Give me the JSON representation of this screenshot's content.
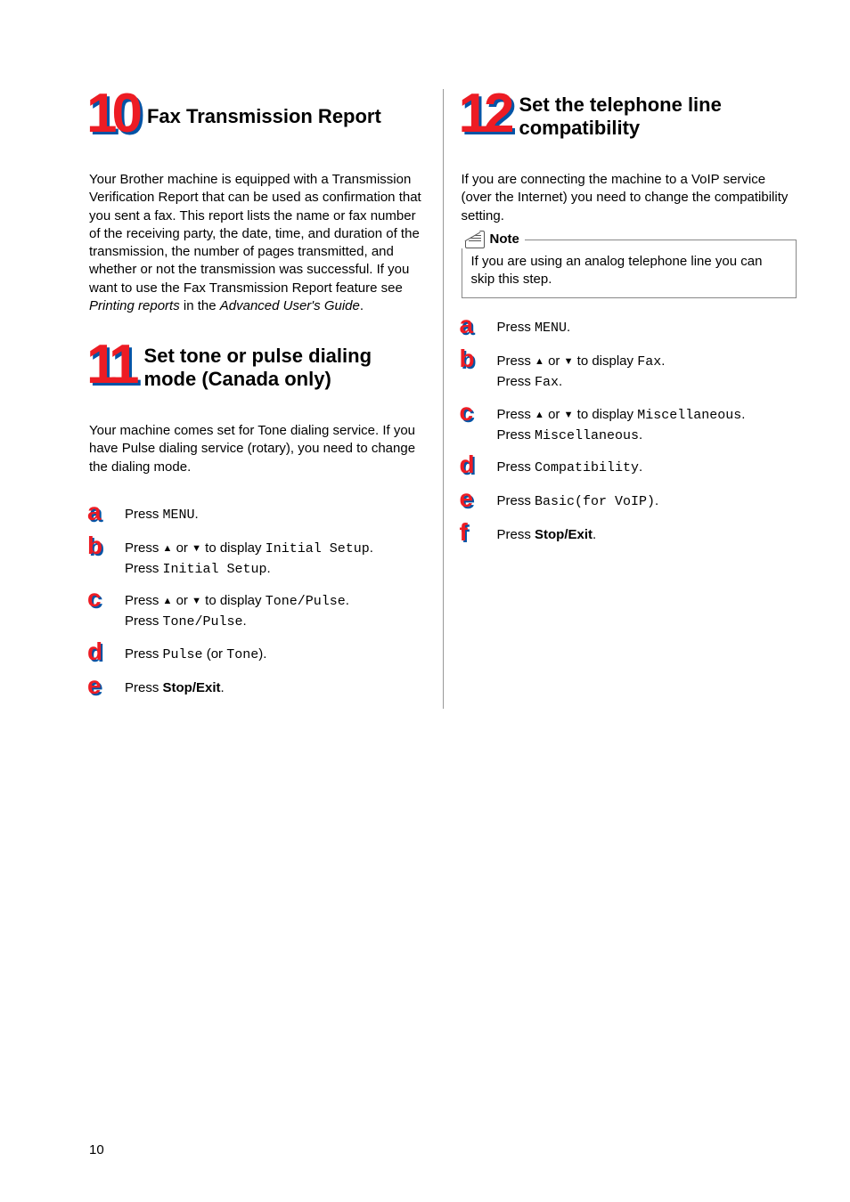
{
  "page_number": "10",
  "left": {
    "sections": [
      {
        "num": "10",
        "title": "Fax Transmission Report",
        "body_parts": [
          "Your Brother machine is equipped with a Transmission Verification Report that can be used as confirmation that you sent a fax. This report lists the name or fax number of the receiving party, the date, time, and duration of the transmission, the number of pages transmitted, and whether or not the transmission was successful. If you want to use the Fax Transmission Report feature see ",
          "Printing reports",
          " in the ",
          "Advanced User's Guide",
          "."
        ]
      },
      {
        "num": "11",
        "title": "Set tone or pulse dialing mode (Canada only)",
        "body": "Your machine comes set for Tone dialing service. If you have Pulse dialing service (rotary), you need to change the dialing mode.",
        "steps": {
          "a": {
            "t1": "Press ",
            "m1": "MENU",
            "t2": "."
          },
          "b": {
            "line1": {
              "t1": "Press ",
              "up": "▲",
              "mid": " or ",
              "down": "▼",
              "t2": " to display ",
              "m1": "Initial Setup",
              "t3": "."
            },
            "line2": {
              "t1": "Press ",
              "m1": "Initial Setup",
              "t2": "."
            }
          },
          "c": {
            "line1": {
              "t1": "Press ",
              "up": "▲",
              "mid": " or ",
              "down": "▼",
              "t2": " to display ",
              "m1": "Tone/Pulse",
              "t3": "."
            },
            "line2": {
              "t1": "Press ",
              "m1": "Tone/Pulse",
              "t2": "."
            }
          },
          "d": {
            "t1": "Press ",
            "m1": "Pulse",
            "t2": " (or ",
            "m2": "Tone",
            "t3": ")."
          },
          "e": {
            "t1": "Press ",
            "b1": "Stop/Exit",
            "t2": "."
          }
        }
      }
    ]
  },
  "right": {
    "section": {
      "num": "12",
      "title": "Set the telephone line compatibility",
      "body": "If you are connecting the machine to a VoIP service (over the Internet) you need to change the compatibility setting.",
      "note_label": "Note",
      "note_text": "If you are using an analog telephone line you can skip this step.",
      "steps": {
        "a": {
          "t1": "Press ",
          "m1": "MENU",
          "t2": "."
        },
        "b": {
          "line1": {
            "t1": "Press ",
            "up": "▲",
            "mid": " or ",
            "down": "▼",
            "t2": " to display ",
            "m1": "Fax",
            "t3": "."
          },
          "line2": {
            "t1": "Press ",
            "m1": "Fax",
            "t2": "."
          }
        },
        "c": {
          "line1": {
            "t1": "Press ",
            "up": "▲",
            "mid": " or ",
            "down": "▼",
            "t2": " to display ",
            "m1": "Miscellaneous",
            "t3": "."
          },
          "line2": {
            "t1": "Press ",
            "m1": "Miscellaneous",
            "t2": "."
          }
        },
        "d": {
          "t1": "Press ",
          "m1": "Compatibility",
          "t2": "."
        },
        "e": {
          "t1": "Press ",
          "m1": "Basic(for VoIP)",
          "t2": "."
        },
        "f": {
          "t1": "Press ",
          "b1": "Stop/Exit",
          "t2": "."
        }
      }
    }
  }
}
